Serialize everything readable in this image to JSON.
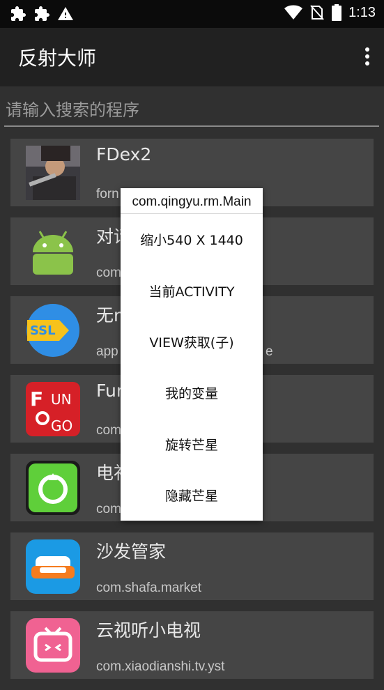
{
  "status_bar": {
    "left_icons": [
      "puzzle-icon",
      "puzzle-icon",
      "warning-icon"
    ],
    "right_icons": [
      "wifi-icon",
      "no-sim-icon",
      "battery-icon"
    ],
    "time": "1:13"
  },
  "app_bar": {
    "title": "反射大师",
    "overflow_icon": "more-vert-icon"
  },
  "search": {
    "placeholder": "请输入搜索的程序",
    "value": ""
  },
  "apps": [
    {
      "name": "FDex2",
      "package": "forn",
      "icon": "fdex2-icon"
    },
    {
      "name": "对话",
      "package": "com.",
      "icon": "android-icon"
    },
    {
      "name": "无n",
      "package": "app",
      "package_tail": "e",
      "icon": "ssl-icon"
    },
    {
      "name": "Fur",
      "package": "com.",
      "icon": "fungo-icon"
    },
    {
      "name": "电补",
      "package": "com.",
      "icon": "rocket-icon"
    },
    {
      "name": "沙发管家",
      "package": "com.shafa.market",
      "icon": "sofa-icon"
    },
    {
      "name": "云视听小电视",
      "package": "com.xiaodianshi.tv.yst",
      "icon": "tv-icon"
    }
  ],
  "popup_menu": {
    "title": "com.qingyu.rm.Main",
    "items": [
      "缩小540 X 1440",
      "当前ACTIVITY",
      "VIEW获取(子)",
      "我的变量",
      "旋转芒星",
      "隐藏芒星"
    ]
  },
  "colors": {
    "background": "#303030",
    "appbar": "#212121",
    "statusbar": "#0b0b0b",
    "list_item": "#454545",
    "menu_bg": "#ffffff"
  }
}
